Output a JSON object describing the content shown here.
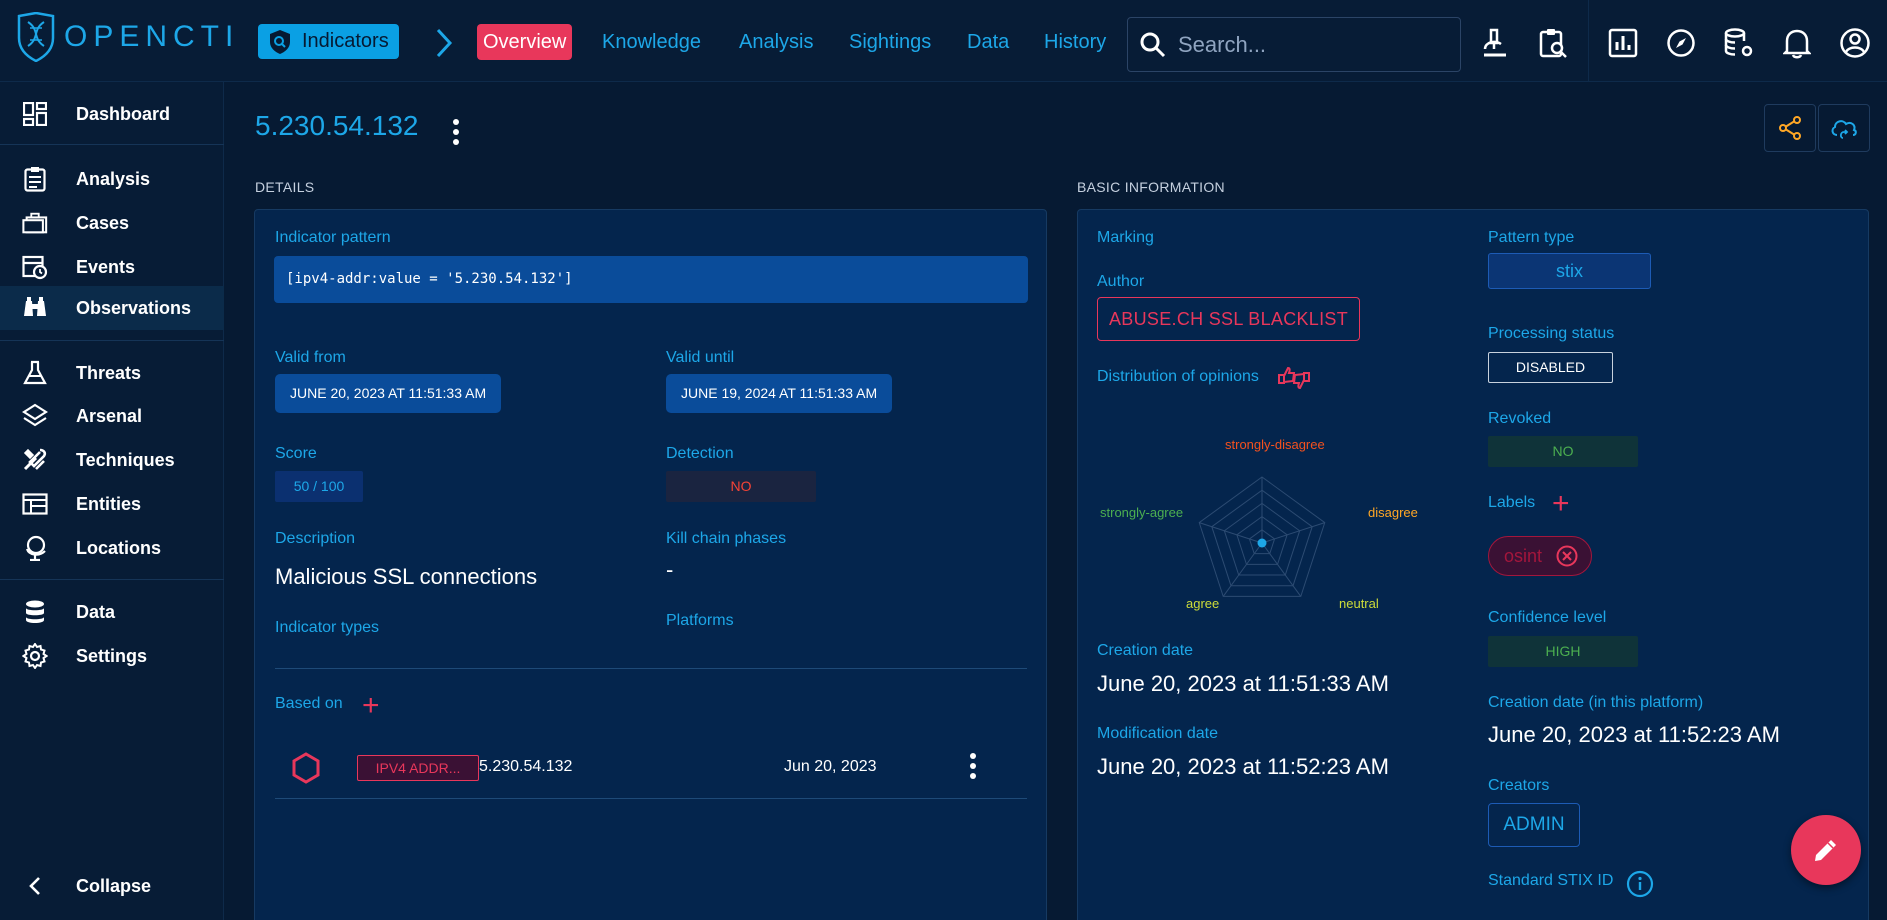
{
  "app": {
    "logo_text": "OPENCTI"
  },
  "breadcrumb": {
    "section": "Indicators"
  },
  "tabs": [
    "Overview",
    "Knowledge",
    "Analysis",
    "Sightings",
    "Data",
    "History"
  ],
  "search": {
    "placeholder": "Search..."
  },
  "sidebar": {
    "items": [
      {
        "label": "Dashboard",
        "icon": "dashboard-icon"
      },
      {
        "label": "Analysis",
        "icon": "clipboard-icon"
      },
      {
        "label": "Cases",
        "icon": "briefcase-icon"
      },
      {
        "label": "Events",
        "icon": "calendar-clock-icon"
      },
      {
        "label": "Observations",
        "icon": "binoculars-icon"
      },
      {
        "label": "Threats",
        "icon": "flask-icon"
      },
      {
        "label": "Arsenal",
        "icon": "layers-icon"
      },
      {
        "label": "Techniques",
        "icon": "tools-icon"
      },
      {
        "label": "Entities",
        "icon": "table-icon"
      },
      {
        "label": "Locations",
        "icon": "globe-icon"
      },
      {
        "label": "Data",
        "icon": "database-icon"
      },
      {
        "label": "Settings",
        "icon": "gear-icon"
      }
    ],
    "active": "Observations",
    "collapse_label": "Collapse"
  },
  "entity": {
    "title": "5.230.54.132"
  },
  "details": {
    "section_title": "DETAILS",
    "pattern_label": "Indicator pattern",
    "pattern_value": "[ipv4-addr:value = '5.230.54.132']",
    "valid_from_label": "Valid from",
    "valid_from": "JUNE 20, 2023 AT 11:51:33 AM",
    "valid_until_label": "Valid until",
    "valid_until": "JUNE 19, 2024 AT 11:51:33 AM",
    "score_label": "Score",
    "score": "50 / 100",
    "detection_label": "Detection",
    "detection": "NO",
    "description_label": "Description",
    "description": "Malicious SSL connections",
    "kill_chain_label": "Kill chain phases",
    "kill_chain_value": "-",
    "indicator_types_label": "Indicator types",
    "platforms_label": "Platforms",
    "based_on_label": "Based on",
    "based_on": [
      {
        "type": "IPV4 ADDR...",
        "value": "5.230.54.132",
        "date": "Jun 20, 2023"
      }
    ]
  },
  "basic": {
    "section_title": "BASIC INFORMATION",
    "marking_label": "Marking",
    "author_label": "Author",
    "author": "ABUSE.CH SSL BLACKLIST",
    "opinions_label": "Distribution of opinions",
    "radar": {
      "axes": [
        "strongly-disagree",
        "disagree",
        "neutral",
        "agree",
        "strongly-agree"
      ],
      "colors": [
        "#f4511e",
        "#ffa726",
        "#cddc39",
        "#cddc39",
        "#4caf50"
      ]
    },
    "creation_date_label": "Creation date",
    "creation_date": "June 20, 2023 at 11:51:33 AM",
    "modification_date_label": "Modification date",
    "modification_date": "June 20, 2023 at 11:52:23 AM",
    "pattern_type_label": "Pattern type",
    "pattern_type": "stix",
    "processing_status_label": "Processing status",
    "processing_status": "DISABLED",
    "revoked_label": "Revoked",
    "revoked": "NO",
    "labels_label": "Labels",
    "labels": [
      "osint"
    ],
    "confidence_label": "Confidence level",
    "confidence": "HIGH",
    "platform_creation_label": "Creation date (in this platform)",
    "platform_creation": "June 20, 2023 at 11:52:23 AM",
    "creators_label": "Creators",
    "creators": [
      "ADMIN"
    ],
    "stix_id_label": "Standard STIX ID"
  },
  "colors": {
    "accent": "#1da7e8",
    "pink": "#e8375b",
    "bg": "#061a33",
    "panel": "#04254d",
    "chip": "#0a4c9a",
    "green": "#4caf50",
    "red": "#f44336"
  }
}
